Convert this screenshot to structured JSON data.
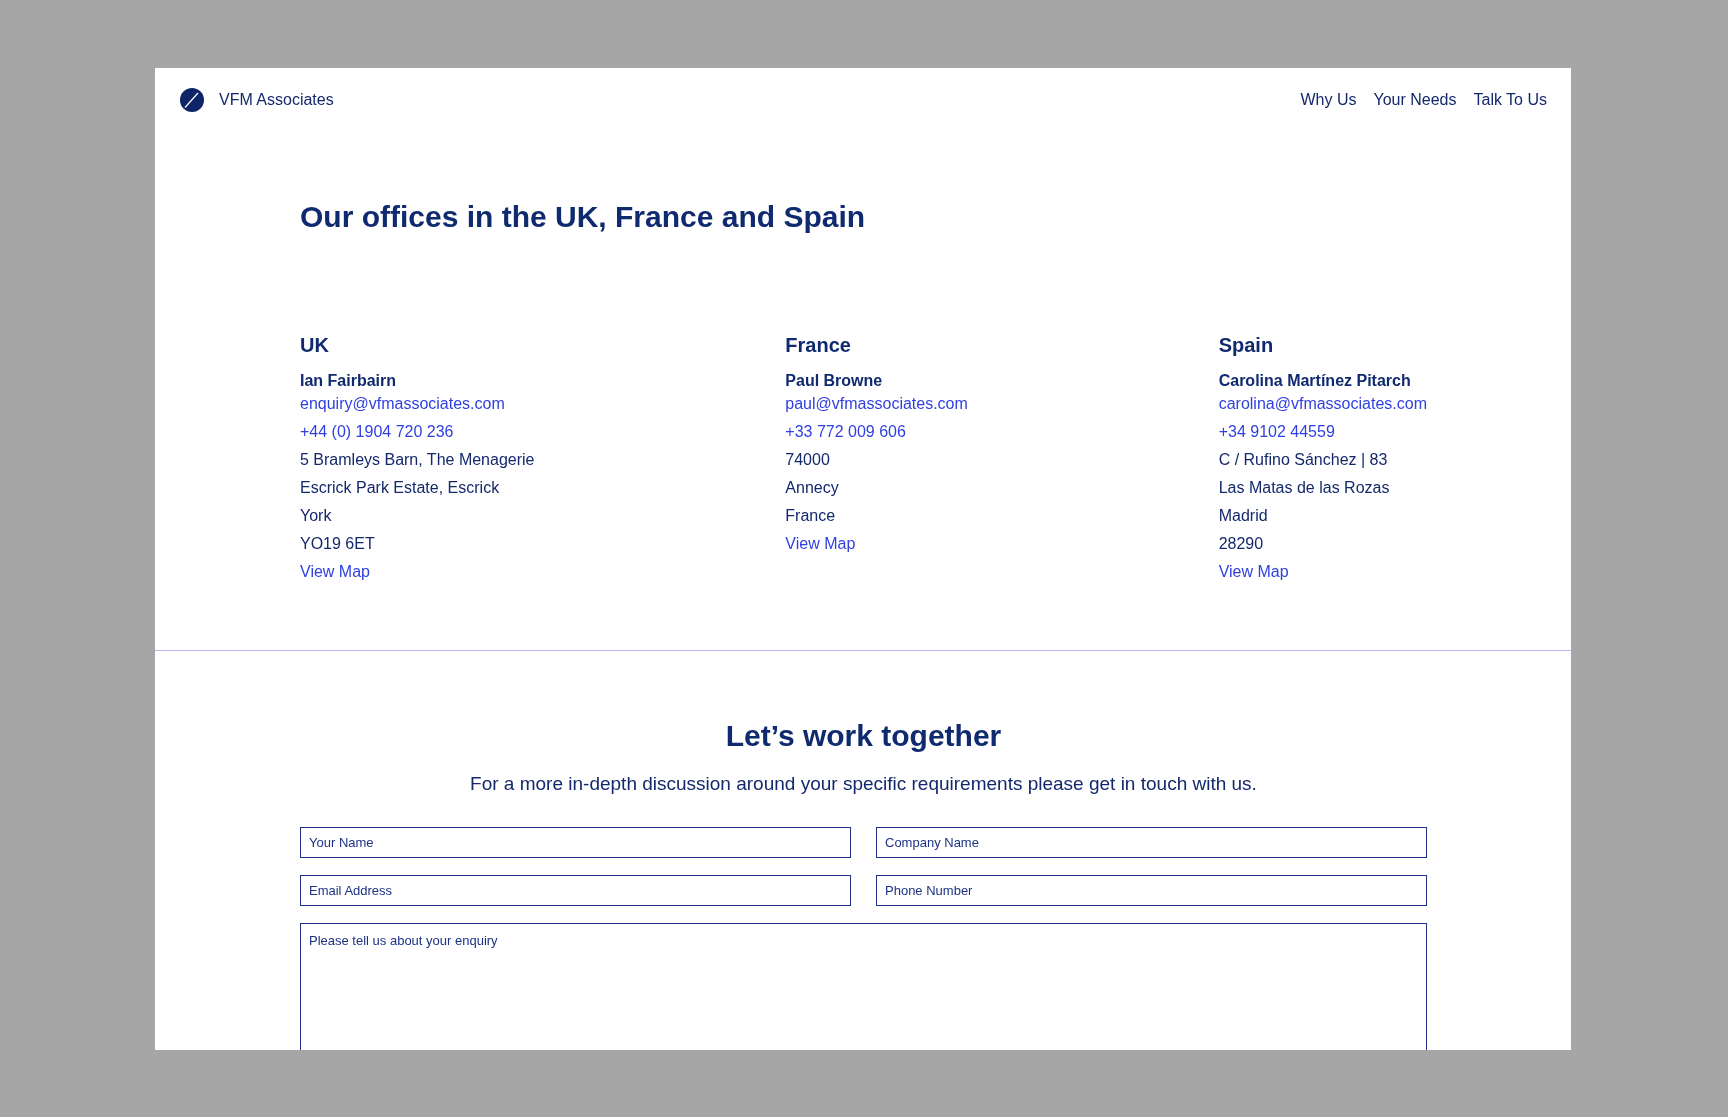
{
  "header": {
    "brand": "VFM Associates",
    "nav": [
      {
        "label": "Why Us"
      },
      {
        "label": "Your Needs"
      },
      {
        "label": "Talk To Us"
      }
    ]
  },
  "offices": {
    "title": "Our offices in the UK, France and Spain",
    "columns": [
      {
        "country": "UK",
        "contact": "Ian Fairbairn",
        "email": "enquiry@vfmassociates.com",
        "phone": "+44 (0) 1904 720 236",
        "address": [
          "5 Bramleys Barn, The Menagerie",
          "Escrick Park Estate, Escrick",
          "York",
          "YO19 6ET"
        ],
        "map_link": "View Map"
      },
      {
        "country": "France",
        "contact": "Paul Browne",
        "email": "paul@vfmassociates.com",
        "phone": "+33 772 009 606",
        "address": [
          "74000",
          "Annecy",
          "France"
        ],
        "map_link": "View Map"
      },
      {
        "country": "Spain",
        "contact": "Carolina Martínez Pitarch",
        "email": "carolina@vfmassociates.com",
        "phone": "+34 9102 44559",
        "address": [
          "C / Rufino Sánchez | 83",
          "Las Matas de las Rozas",
          "Madrid",
          "28290"
        ],
        "map_link": "View Map"
      }
    ]
  },
  "contact": {
    "title": "Let’s work together",
    "intro": "For a more in-depth discussion around your specific requirements please get in touch with us.",
    "fields": [
      {
        "kind": "input",
        "placeholder": "Your Name"
      },
      {
        "kind": "input",
        "placeholder": "Company Name"
      },
      {
        "kind": "input",
        "placeholder": "Email Address"
      },
      {
        "kind": "input",
        "placeholder": "Phone Number"
      },
      {
        "kind": "textarea",
        "placeholder": "Please tell us about your enquiry"
      }
    ]
  }
}
